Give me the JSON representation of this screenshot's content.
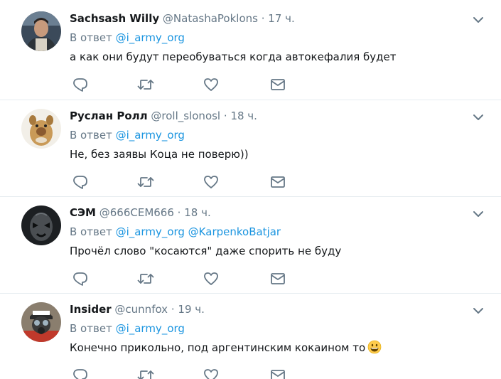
{
  "tweets": [
    {
      "name": "Sachsash Willy",
      "handle": "@NatashaPoklons",
      "dot": "·",
      "time": "17 ч.",
      "reply_prefix": "В ответ",
      "reply_mentions": "@i_army_org",
      "text": "а как они будут переобуваться когда автокефалия будет",
      "avatar": "man-avatar"
    },
    {
      "name": "Руслан Ролл",
      "handle": "@roll_slonosl",
      "dot": "·",
      "time": "18 ч.",
      "reply_prefix": "В ответ",
      "reply_mentions": "@i_army_org",
      "text": "Не, без заявы Коца не поверю))",
      "avatar": "alf-avatar"
    },
    {
      "name": "СЭМ",
      "handle": "@666CEM666",
      "dot": "·",
      "time": "18 ч.",
      "reply_prefix": "В ответ",
      "reply_mentions": "@i_army_org @KarpenkoBatjar",
      "text": "Прочёл слово \"косаются\" даже спорить не буду",
      "avatar": "mask-avatar"
    },
    {
      "name": "Insider",
      "handle": "@cunnfox",
      "dot": "·",
      "time": "19 ч.",
      "reply_prefix": "В ответ",
      "reply_mentions": "@i_army_org",
      "text": "Конечно прикольно, под аргентинским кокаином то",
      "avatar": "press-gasmask-avatar",
      "emoji": "grinning-face-emoji"
    }
  ],
  "icons": {
    "reply": "reply-icon",
    "retweet": "retweet-icon",
    "like": "heart-icon",
    "dm": "envelope-icon",
    "caret": "chevron-down-icon"
  },
  "colors": {
    "name": "#14171a",
    "secondary": "#657786",
    "mention": "#1b95e0",
    "icon": "#657786",
    "divider": "#e6ecf0"
  }
}
